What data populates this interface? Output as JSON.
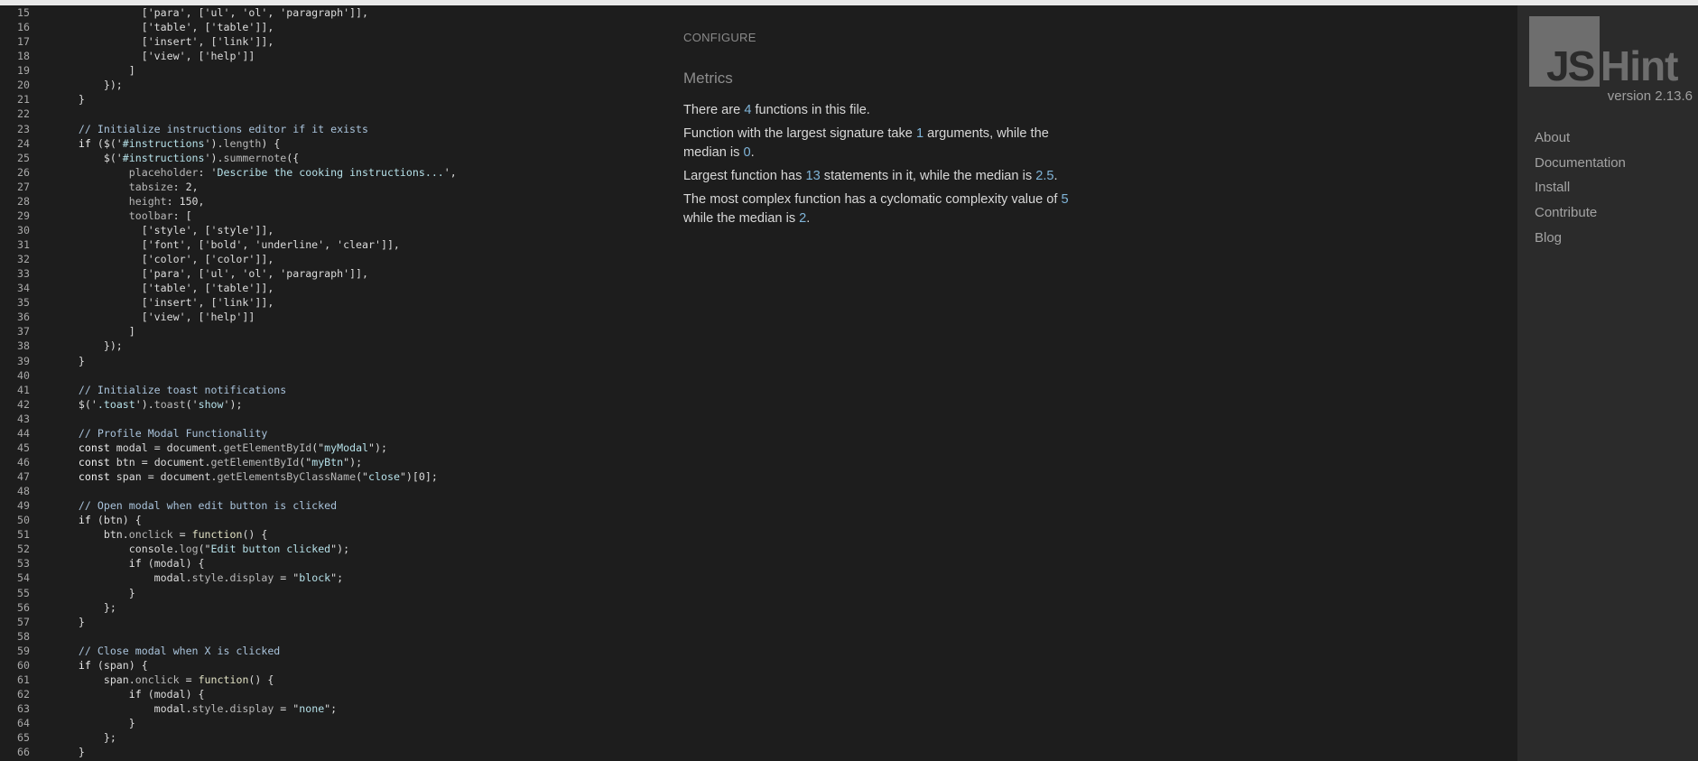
{
  "editor": {
    "lines": [
      {
        "n": "15",
        "tokens": [
          [
            "punc",
            "              ['para', ['ul', 'ol', 'paragraph']],"
          ]
        ]
      },
      {
        "n": "16",
        "tokens": [
          [
            "punc",
            "              ['table', ['table']],"
          ]
        ]
      },
      {
        "n": "17",
        "tokens": [
          [
            "punc",
            "              ['insert', ['link']],"
          ]
        ]
      },
      {
        "n": "18",
        "tokens": [
          [
            "punc",
            "              ['view', ['help']]"
          ]
        ]
      },
      {
        "n": "19",
        "tokens": [
          [
            "punc",
            "            ]"
          ]
        ]
      },
      {
        "n": "20",
        "tokens": [
          [
            "punc",
            "        });"
          ]
        ]
      },
      {
        "n": "21",
        "tokens": [
          [
            "punc",
            "    }"
          ]
        ]
      },
      {
        "n": "22",
        "tokens": [
          [
            "punc",
            ""
          ]
        ]
      },
      {
        "n": "23",
        "tokens": [
          [
            "com",
            "    // Initialize instructions editor if it exists"
          ]
        ]
      },
      {
        "n": "24",
        "tokens": [
          [
            "kw",
            "    if"
          ],
          [
            "punc",
            " ($('"
          ],
          [
            "str",
            "#instructions"
          ],
          [
            "punc",
            "')."
          ],
          [
            "prop",
            "length"
          ],
          [
            "punc",
            ") {"
          ]
        ]
      },
      {
        "n": "25",
        "tokens": [
          [
            "punc",
            "        $('"
          ],
          [
            "str",
            "#instructions"
          ],
          [
            "punc",
            "')."
          ],
          [
            "prop",
            "summernote"
          ],
          [
            "punc",
            "({"
          ]
        ]
      },
      {
        "n": "26",
        "tokens": [
          [
            "prop",
            "            placeholder"
          ],
          [
            "punc",
            ": '"
          ],
          [
            "str",
            "Describe the cooking instructions..."
          ],
          [
            "punc",
            "',"
          ]
        ]
      },
      {
        "n": "27",
        "tokens": [
          [
            "prop",
            "            tabsize"
          ],
          [
            "punc",
            ": 2,"
          ]
        ]
      },
      {
        "n": "28",
        "tokens": [
          [
            "prop",
            "            height"
          ],
          [
            "punc",
            ": 150,"
          ]
        ]
      },
      {
        "n": "29",
        "tokens": [
          [
            "prop",
            "            toolbar"
          ],
          [
            "punc",
            ": ["
          ]
        ]
      },
      {
        "n": "30",
        "tokens": [
          [
            "punc",
            "              ['style', ['style']],"
          ]
        ]
      },
      {
        "n": "31",
        "tokens": [
          [
            "punc",
            "              ['font', ['bold', 'underline', 'clear']],"
          ]
        ]
      },
      {
        "n": "32",
        "tokens": [
          [
            "punc",
            "              ['color', ['color']],"
          ]
        ]
      },
      {
        "n": "33",
        "tokens": [
          [
            "punc",
            "              ['para', ['ul', 'ol', 'paragraph']],"
          ]
        ]
      },
      {
        "n": "34",
        "tokens": [
          [
            "punc",
            "              ['table', ['table']],"
          ]
        ]
      },
      {
        "n": "35",
        "tokens": [
          [
            "punc",
            "              ['insert', ['link']],"
          ]
        ]
      },
      {
        "n": "36",
        "tokens": [
          [
            "punc",
            "              ['view', ['help']]"
          ]
        ]
      },
      {
        "n": "37",
        "tokens": [
          [
            "punc",
            "            ]"
          ]
        ]
      },
      {
        "n": "38",
        "tokens": [
          [
            "punc",
            "        });"
          ]
        ]
      },
      {
        "n": "39",
        "tokens": [
          [
            "punc",
            "    }"
          ]
        ]
      },
      {
        "n": "40",
        "tokens": [
          [
            "punc",
            ""
          ]
        ]
      },
      {
        "n": "41",
        "tokens": [
          [
            "com",
            "    // Initialize toast notifications"
          ]
        ]
      },
      {
        "n": "42",
        "tokens": [
          [
            "punc",
            "    $('"
          ],
          [
            "str",
            ".toast"
          ],
          [
            "punc",
            "')."
          ],
          [
            "prop",
            "toast"
          ],
          [
            "punc",
            "('"
          ],
          [
            "str",
            "show"
          ],
          [
            "punc",
            "');"
          ]
        ]
      },
      {
        "n": "43",
        "tokens": [
          [
            "punc",
            ""
          ]
        ]
      },
      {
        "n": "44",
        "tokens": [
          [
            "com",
            "    // Profile Modal Functionality"
          ]
        ]
      },
      {
        "n": "45",
        "tokens": [
          [
            "kw",
            "    const"
          ],
          [
            "punc",
            " modal = document."
          ],
          [
            "prop",
            "getElementById"
          ],
          [
            "punc",
            "(\""
          ],
          [
            "str",
            "myModal"
          ],
          [
            "punc",
            "\");"
          ]
        ]
      },
      {
        "n": "46",
        "tokens": [
          [
            "kw",
            "    const"
          ],
          [
            "punc",
            " btn = document."
          ],
          [
            "prop",
            "getElementById"
          ],
          [
            "punc",
            "(\""
          ],
          [
            "str",
            "myBtn"
          ],
          [
            "punc",
            "\");"
          ]
        ]
      },
      {
        "n": "47",
        "tokens": [
          [
            "kw",
            "    const"
          ],
          [
            "punc",
            " span = document."
          ],
          [
            "prop",
            "getElementsByClassName"
          ],
          [
            "punc",
            "(\""
          ],
          [
            "str",
            "close"
          ],
          [
            "punc",
            "\")[0];"
          ]
        ]
      },
      {
        "n": "48",
        "tokens": [
          [
            "punc",
            ""
          ]
        ]
      },
      {
        "n": "49",
        "tokens": [
          [
            "com",
            "    // Open modal when edit button is clicked"
          ]
        ]
      },
      {
        "n": "50",
        "tokens": [
          [
            "kw",
            "    if"
          ],
          [
            "punc",
            " (btn) {"
          ]
        ]
      },
      {
        "n": "51",
        "tokens": [
          [
            "punc",
            "        btn."
          ],
          [
            "prop",
            "onclick"
          ],
          [
            "punc",
            " = "
          ],
          [
            "fn",
            "function"
          ],
          [
            "punc",
            "() {"
          ]
        ]
      },
      {
        "n": "52",
        "tokens": [
          [
            "punc",
            "            console."
          ],
          [
            "prop",
            "log"
          ],
          [
            "punc",
            "(\""
          ],
          [
            "str",
            "Edit button clicked"
          ],
          [
            "punc",
            "\");"
          ]
        ]
      },
      {
        "n": "53",
        "tokens": [
          [
            "kw",
            "            if"
          ],
          [
            "punc",
            " (modal) {"
          ]
        ]
      },
      {
        "n": "54",
        "tokens": [
          [
            "punc",
            "                modal."
          ],
          [
            "prop",
            "style"
          ],
          [
            "punc",
            "."
          ],
          [
            "prop",
            "display"
          ],
          [
            "punc",
            " = \""
          ],
          [
            "str",
            "block"
          ],
          [
            "punc",
            "\";"
          ]
        ]
      },
      {
        "n": "55",
        "tokens": [
          [
            "punc",
            "            }"
          ]
        ]
      },
      {
        "n": "56",
        "tokens": [
          [
            "punc",
            "        };"
          ]
        ]
      },
      {
        "n": "57",
        "tokens": [
          [
            "punc",
            "    }"
          ]
        ]
      },
      {
        "n": "58",
        "tokens": [
          [
            "punc",
            ""
          ]
        ]
      },
      {
        "n": "59",
        "tokens": [
          [
            "com",
            "    // Close modal when X is clicked"
          ]
        ]
      },
      {
        "n": "60",
        "tokens": [
          [
            "kw",
            "    if"
          ],
          [
            "punc",
            " (span) {"
          ]
        ]
      },
      {
        "n": "61",
        "tokens": [
          [
            "punc",
            "        span."
          ],
          [
            "prop",
            "onclick"
          ],
          [
            "punc",
            " = "
          ],
          [
            "fn",
            "function"
          ],
          [
            "punc",
            "() {"
          ]
        ]
      },
      {
        "n": "62",
        "tokens": [
          [
            "kw",
            "            if"
          ],
          [
            "punc",
            " (modal) {"
          ]
        ]
      },
      {
        "n": "63",
        "tokens": [
          [
            "punc",
            "                modal."
          ],
          [
            "prop",
            "style"
          ],
          [
            "punc",
            "."
          ],
          [
            "prop",
            "display"
          ],
          [
            "punc",
            " = \""
          ],
          [
            "str",
            "none"
          ],
          [
            "punc",
            "\";"
          ]
        ]
      },
      {
        "n": "64",
        "tokens": [
          [
            "punc",
            "            }"
          ]
        ]
      },
      {
        "n": "65",
        "tokens": [
          [
            "punc",
            "        };"
          ]
        ]
      },
      {
        "n": "66",
        "tokens": [
          [
            "punc",
            "    }"
          ]
        ]
      }
    ]
  },
  "report": {
    "configure_label": "CONFIGURE",
    "metrics_title": "Metrics",
    "metrics": [
      [
        [
          "t",
          "There are "
        ],
        [
          "n",
          "4"
        ],
        [
          "t",
          " functions in this file."
        ]
      ],
      [
        [
          "t",
          "Function with the largest signature take "
        ],
        [
          "n",
          "1"
        ],
        [
          "t",
          " arguments, while the median is "
        ],
        [
          "n",
          "0"
        ],
        [
          "t",
          "."
        ]
      ],
      [
        [
          "t",
          "Largest function has "
        ],
        [
          "n",
          "13"
        ],
        [
          "t",
          " statements in it, while the median is "
        ],
        [
          "n",
          "2.5"
        ],
        [
          "t",
          "."
        ]
      ],
      [
        [
          "t",
          "The most complex function has a cyclomatic complexity value of "
        ],
        [
          "n",
          "5"
        ],
        [
          "t",
          " while the median is "
        ],
        [
          "n",
          "2"
        ],
        [
          "t",
          "."
        ]
      ]
    ]
  },
  "sidebar": {
    "logo_js": "JS",
    "logo_hint": "Hint",
    "version": "version 2.13.6",
    "nav": [
      "About",
      "Documentation",
      "Install",
      "Contribute",
      "Blog"
    ]
  },
  "colors": {
    "background": "#1d1d1d",
    "sidebar": "#2b2b2b",
    "number_accent": "#7fb4d8",
    "logo_gray": "#6e6e6e"
  }
}
